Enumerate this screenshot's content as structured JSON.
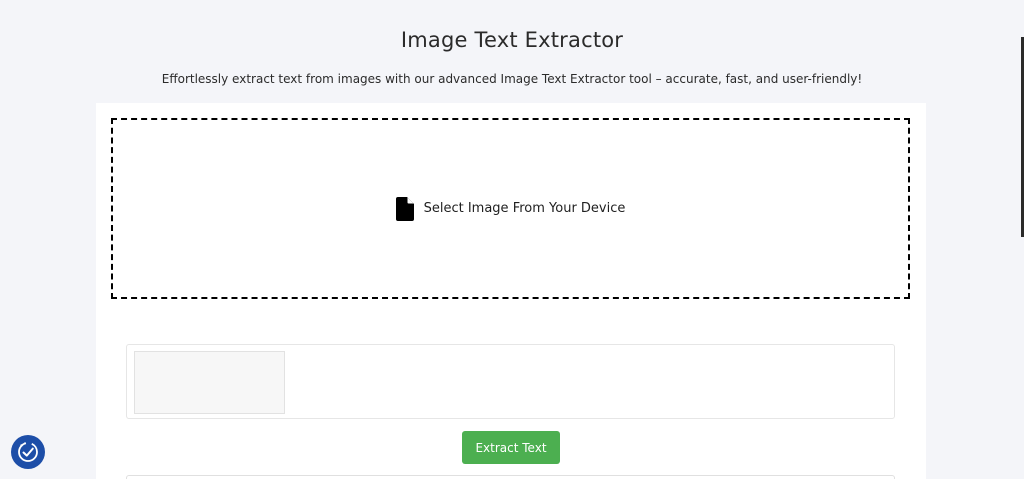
{
  "header": {
    "title": "Image Text Extractor",
    "subtitle": "Effortlessly extract text from images with our advanced Image Text Extractor tool – accurate, fast, and user-friendly!"
  },
  "upload": {
    "label": "Select Image From Your Device",
    "icon": "file-icon"
  },
  "actions": {
    "extract_label": "Extract Text",
    "extract_color": "#4caf50"
  },
  "accessibility": {
    "icon": "accessibility-check-icon",
    "color": "#1d4ea8"
  }
}
